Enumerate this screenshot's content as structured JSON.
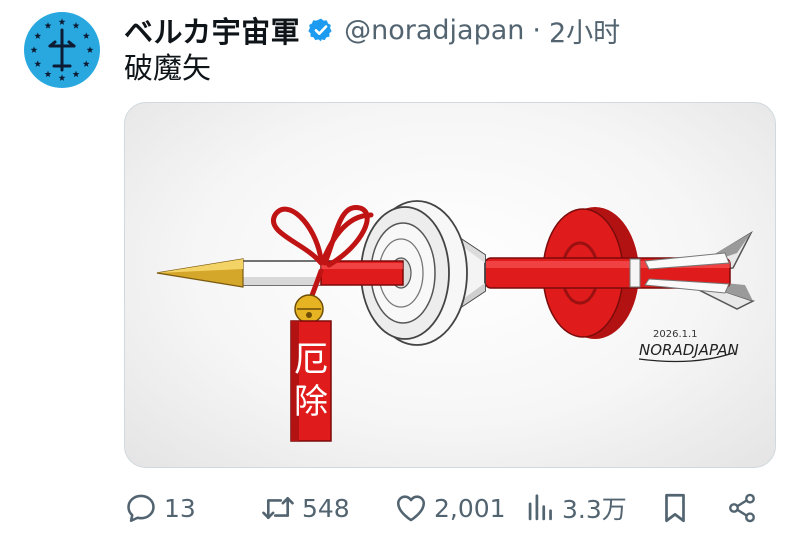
{
  "tweet": {
    "display_name": "ベルカ宇宙軍",
    "handle": "@noradjapan",
    "separator": "·",
    "time": "2小时",
    "text": "破魔矢"
  },
  "media": {
    "charm_text": "厄除",
    "signature_date": "2026.1.1",
    "signature_name": "NORADJAPAN"
  },
  "actions": {
    "replies": "13",
    "reposts": "548",
    "likes": "2,001",
    "views": "3.3万"
  },
  "colors": {
    "avatar_blue": "#29a8e0",
    "verified_blue": "#1d9bf0",
    "arrow_red": "#e01b1b",
    "muted_text": "#536471"
  }
}
